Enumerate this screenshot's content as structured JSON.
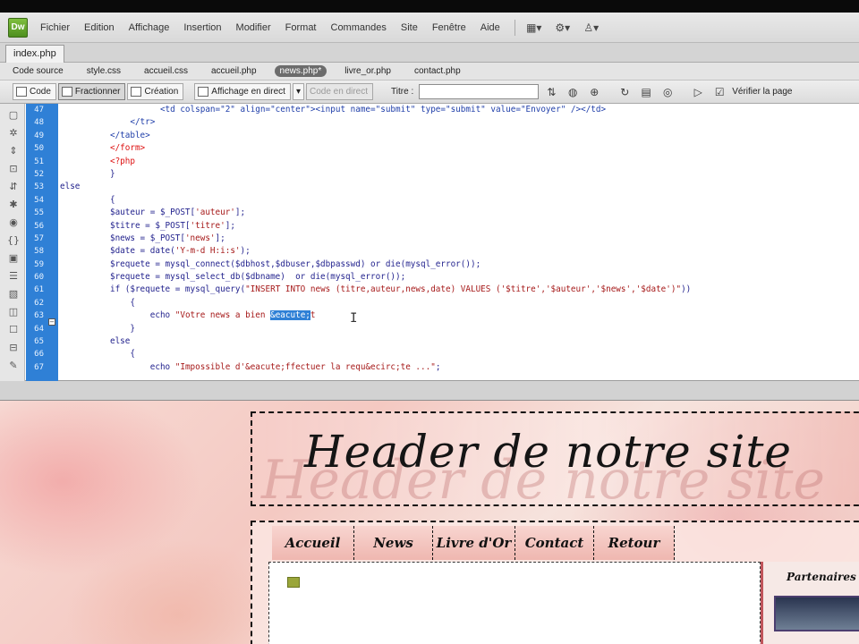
{
  "app": {
    "logo": "Dw"
  },
  "menu": {
    "items": [
      "Fichier",
      "Edition",
      "Affichage",
      "Insertion",
      "Modifier",
      "Format",
      "Commandes",
      "Site",
      "Fenêtre",
      "Aide"
    ],
    "icons": [
      "layout-icon",
      "gear-icon",
      "user-icon"
    ]
  },
  "document": {
    "tab": "index.php",
    "related_files": [
      "Code source",
      "style.css",
      "accueil.css",
      "accueil.php",
      "news.php*",
      "livre_or.php",
      "contact.php"
    ],
    "active_related": "news.php*"
  },
  "toolbar": {
    "code": "Code",
    "split": "Fractionner",
    "design": "Création",
    "live": "Affichage en direct",
    "live_code": "Code en direct",
    "title_label": "Titre :",
    "title_value": "",
    "verify": "Vérifier la page"
  },
  "code": {
    "line_numbers": [
      "47",
      "48",
      "49",
      "50",
      "51",
      "52",
      "53",
      "54",
      "55",
      "56",
      "57",
      "58",
      "59",
      "60",
      "61",
      "62",
      "63",
      "64",
      "65",
      "66",
      "67"
    ],
    "selected_entity": "&eacute;"
  },
  "design": {
    "header_text": "Header de notre site",
    "nav": [
      "Accueil",
      "News",
      "Livre d'Or",
      "Contact",
      "Retour"
    ],
    "sidebar_title": "Partenaires"
  },
  "colors": {
    "gutter_highlight": "#2f80d6",
    "dw_logo": "#6aad30",
    "sidebar_border": "#c0555b"
  }
}
